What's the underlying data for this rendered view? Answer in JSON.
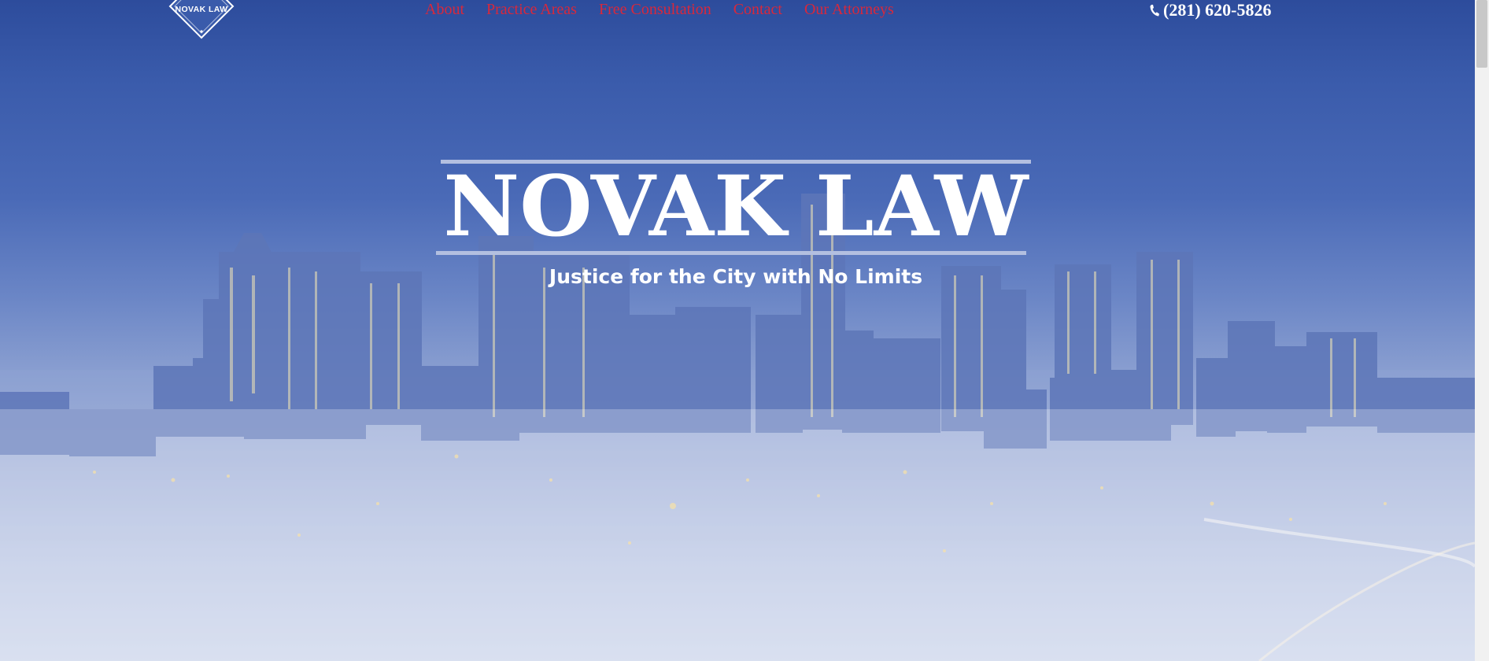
{
  "header": {
    "logo_text": "NOVAK LAW",
    "nav": [
      {
        "label": "About"
      },
      {
        "label": "Practice Areas"
      },
      {
        "label": "Free Consultation"
      },
      {
        "label": "Contact"
      },
      {
        "label": "Our Attorneys"
      }
    ],
    "phone": "(281) 620-5826"
  },
  "hero": {
    "title": "NOVAK LAW",
    "tagline": "Justice for the City with No Limits"
  },
  "colors": {
    "nav_link": "#d8283c",
    "sky_top": "#2d4c9c",
    "title_text": "#ffffff"
  }
}
